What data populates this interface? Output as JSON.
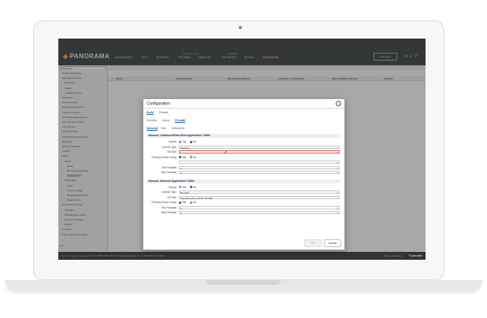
{
  "app": {
    "logo": "PANORAMA",
    "nav": [
      "DASHBOARD",
      "ACC",
      "MONITOR",
      "POLICIES",
      "OBJECTS",
      "NETWORK",
      "DEVICE",
      "PANORAMA"
    ],
    "active_nav": "PANORAMA",
    "context_groups": [
      "Device Groups",
      "Templates"
    ],
    "panorama_selector": "Panorama",
    "util_icons": [
      "refresh-icon",
      "search-icon",
      "help-icon",
      "settings-icon"
    ]
  },
  "sidebar": {
    "location_select": "Panorama",
    "items": [
      "Device Quarantine",
      "Managed Devices",
      "Summary",
      "Health",
      "Troubleshooting",
      "Templates",
      "Device Groups",
      "Managed Collectors",
      "Collector Groups",
      "Certificate Management",
      "Log Ingestion Profile",
      "Log Settings",
      "Server Profiles",
      "Scheduled Config Export",
      "Software",
      "Dynamic Updates",
      "Plugins",
      "AWS",
      "Azure",
      "Setup",
      "Monitoring Definition",
      "Deployments",
      "Kubernetes",
      "Setup",
      "License Usage",
      "Monitoring Definition",
      "Deployments",
      "Device Deployment",
      "Software",
      "GlobalProtect Client",
      "Dynamic Updates",
      "Plugins",
      "Licenses",
      "Policy Recommendation"
    ],
    "selected": "Deployments",
    "commit_label": "Add"
  },
  "table": {
    "headers": [
      "NAME",
      "DESCRIPTION",
      "RESOURCE GROUP",
      "FIREWALL AUTHCODE",
      "DEPLOYMENT STATUS",
      "ACTION"
    ]
  },
  "dialog": {
    "title": "Configuration",
    "tabs": [
      "Build",
      "Protect"
    ],
    "active_tab": "Build",
    "subtabs": [
      "General",
      "Azure",
      "Firewall"
    ],
    "active_subtab": "Firewall",
    "inner_tabs": [
      "Inbound",
      "Hub",
      "Advanced"
    ],
    "active_inner_tab": "Inbound",
    "sections": [
      {
        "title": "Inbound, Outbound/East-West Application Traffic",
        "rows": [
          {
            "label": "Deploy",
            "type": "radio",
            "options": [
              "Yes",
              "No"
            ],
            "selected": "No"
          },
          {
            "label": "License Type",
            "type": "select",
            "value": "Bundle2"
          },
          {
            "label": "VM Size",
            "type": "select",
            "value": "",
            "error": true
          },
          {
            "label": "Existing Device Group",
            "type": "radio",
            "options": [
              "Yes",
              "No"
            ],
            "selected": "Yes"
          },
          {
            "label": "",
            "type": "select",
            "value": ""
          },
          {
            "label": "Min Firewalls",
            "type": "select",
            "value": "2"
          },
          {
            "label": "Max Firewalls",
            "type": "select",
            "value": "3"
          }
        ]
      },
      {
        "title": "Inbound, Inbound Application Traffic",
        "rows": [
          {
            "label": "Deploy",
            "type": "radio",
            "options": [
              "Yes",
              "No"
            ],
            "selected": "No"
          },
          {
            "label": "License Type",
            "type": "select",
            "value": "Bundle2"
          },
          {
            "label": "VM Size",
            "type": "select",
            "value": "Standard_D3_v2 (FW VM 300)"
          },
          {
            "label": "Existing Device Group",
            "type": "radio",
            "options": [
              "Yes",
              "No"
            ],
            "selected": "Yes"
          },
          {
            "label": "Min Firewalls",
            "type": "select",
            "value": "2"
          },
          {
            "label": "Max Firewalls",
            "type": "select",
            "value": "3"
          }
        ]
      }
    ],
    "ok_label": "OK",
    "cancel_label": "Cancel"
  },
  "status_bar": {
    "left": "admin | Logout | Last Login Time: 05/06/2020 10:04:33 | Session Expire Time: 05/13/2020 10:04:33",
    "right": "Tasks | Language",
    "brand": "paloalto"
  },
  "colors": {
    "accent": "#f5a623",
    "topbar": "#2f3336",
    "link": "#1f5fa6"
  }
}
